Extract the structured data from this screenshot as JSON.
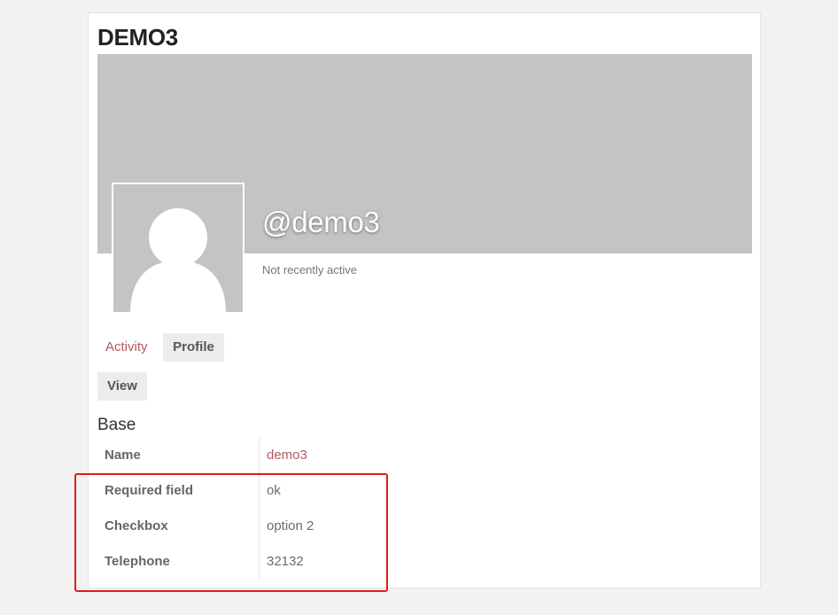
{
  "profile": {
    "title": "DEMO3",
    "handle": "@demo3",
    "activity_status": "Not recently active"
  },
  "nav": {
    "tabs": [
      {
        "label": "Activity",
        "active": false
      },
      {
        "label": "Profile",
        "active": true
      }
    ],
    "subtabs": [
      {
        "label": "View",
        "active": true
      }
    ]
  },
  "fields_group": {
    "title": "Base",
    "rows": [
      {
        "label": "Name",
        "value": "demo3"
      },
      {
        "label": "Required field",
        "value": "ok"
      },
      {
        "label": "Checkbox",
        "value": "option 2"
      },
      {
        "label": "Telephone",
        "value": "32132"
      }
    ]
  },
  "annotation": {
    "highlight_color": "#e01c1c"
  },
  "colors": {
    "accent_link": "#b05a64",
    "cover_gray": "#c4c4c4",
    "active_tab_bg": "#ececec"
  }
}
